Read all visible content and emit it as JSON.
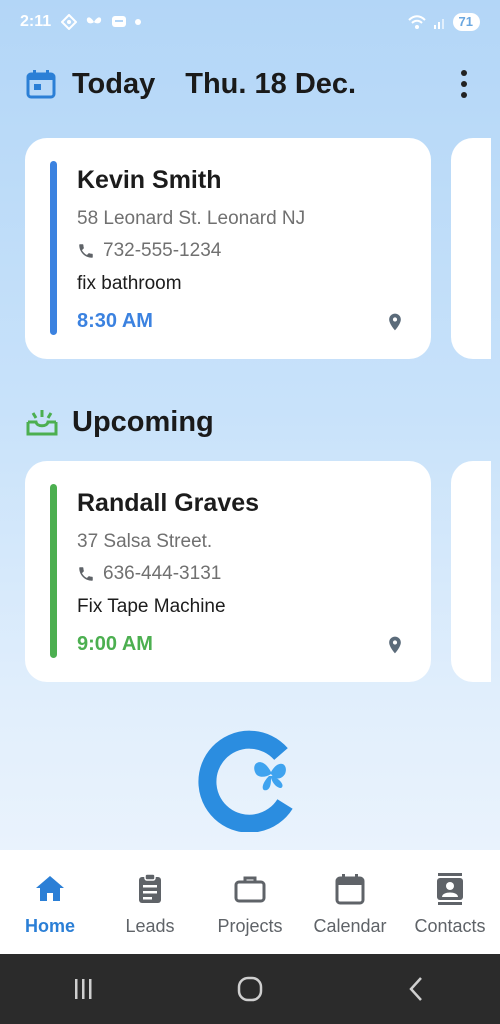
{
  "status_bar": {
    "time": "2:11",
    "battery": "71"
  },
  "header": {
    "title": "Today",
    "date": "Thu. 18 Dec."
  },
  "today_card": {
    "name": "Kevin Smith",
    "address": "58 Leonard St. Leonard NJ",
    "phone": "732-555-1234",
    "note": "fix bathroom",
    "time": "8:30 AM",
    "accent_color": "#3b82e0"
  },
  "upcoming": {
    "title": "Upcoming",
    "card": {
      "name": "Randall Graves",
      "address": "37 Salsa Street.",
      "phone": "636-444-3131",
      "note": "Fix Tape Machine",
      "time": "9:00 AM",
      "accent_color": "#4caf50"
    }
  },
  "bottom_nav": {
    "items": [
      {
        "label": "Home",
        "icon": "home-icon",
        "active": true
      },
      {
        "label": "Leads",
        "icon": "clipboard-icon",
        "active": false
      },
      {
        "label": "Projects",
        "icon": "briefcase-icon",
        "active": false
      },
      {
        "label": "Calendar",
        "icon": "calendar-icon",
        "active": false
      },
      {
        "label": "Contacts",
        "icon": "contacts-icon",
        "active": false
      }
    ]
  },
  "colors": {
    "primary": "#2b7fd6",
    "upcoming_green": "#4caf50",
    "nav_inactive": "#5f6368"
  }
}
